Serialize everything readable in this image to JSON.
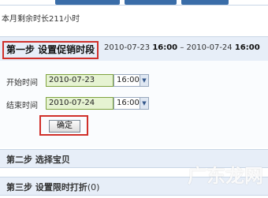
{
  "remaining_time_text": "本月剩余时长211小时",
  "step1": {
    "title": "第一步 设置促销时段",
    "range_start_date": "2010-07-23",
    "range_start_time": "16:00",
    "range_separator": "–",
    "range_end_date": "2010-07-24",
    "range_end_time": "16:00",
    "start_label": "开始时间",
    "start_date_value": "2010-07-23",
    "start_time_value": "16:00",
    "end_label": "结束时间",
    "end_date_value": "2010-07-24",
    "end_time_value": "16:00",
    "confirm_label": "确定"
  },
  "step2": {
    "title": "第二步 选择宝贝"
  },
  "step3": {
    "title": "第三步 设置限时打折",
    "count": "(0)"
  },
  "watermark_text": "广东龙网",
  "colors": {
    "accent_red": "#d0302a",
    "header_bg": "#e7eef8",
    "date_field_bg": "#e6f3d2",
    "tab_blue": "#3a6da8"
  },
  "icons": {
    "select_arrow": "chevron-down-icon"
  }
}
